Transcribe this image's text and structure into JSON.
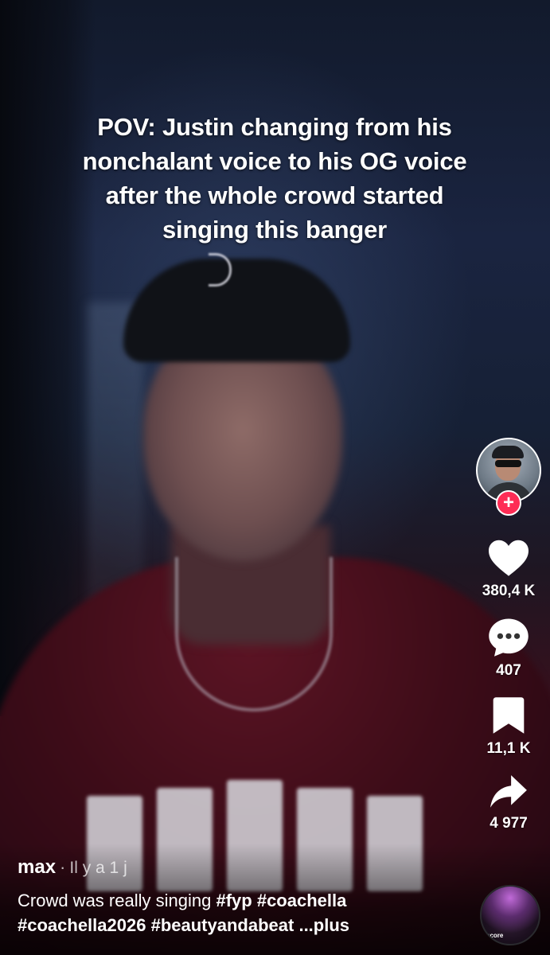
{
  "video": {
    "overlay_text": "POV: Justin changing from his nonchalant voice to his OG voice after the whole crowd started singing this banger"
  },
  "actions": {
    "likes": "380,4 K",
    "comments": "407",
    "saves": "11,1 K",
    "shares": "4 977",
    "follow_symbol": "+"
  },
  "post": {
    "username": "max",
    "separator": "·",
    "time": "Il y a 1 j",
    "description": "Crowd was really singing",
    "hashtags": [
      "#fyp",
      "#coachella",
      "#coachella2026",
      "#beautyandabeat"
    ],
    "more_label": "...plus"
  },
  "sound": {
    "disc_label": "score"
  },
  "colors": {
    "follow_accent": "#fe2c55",
    "text": "#ffffff"
  }
}
